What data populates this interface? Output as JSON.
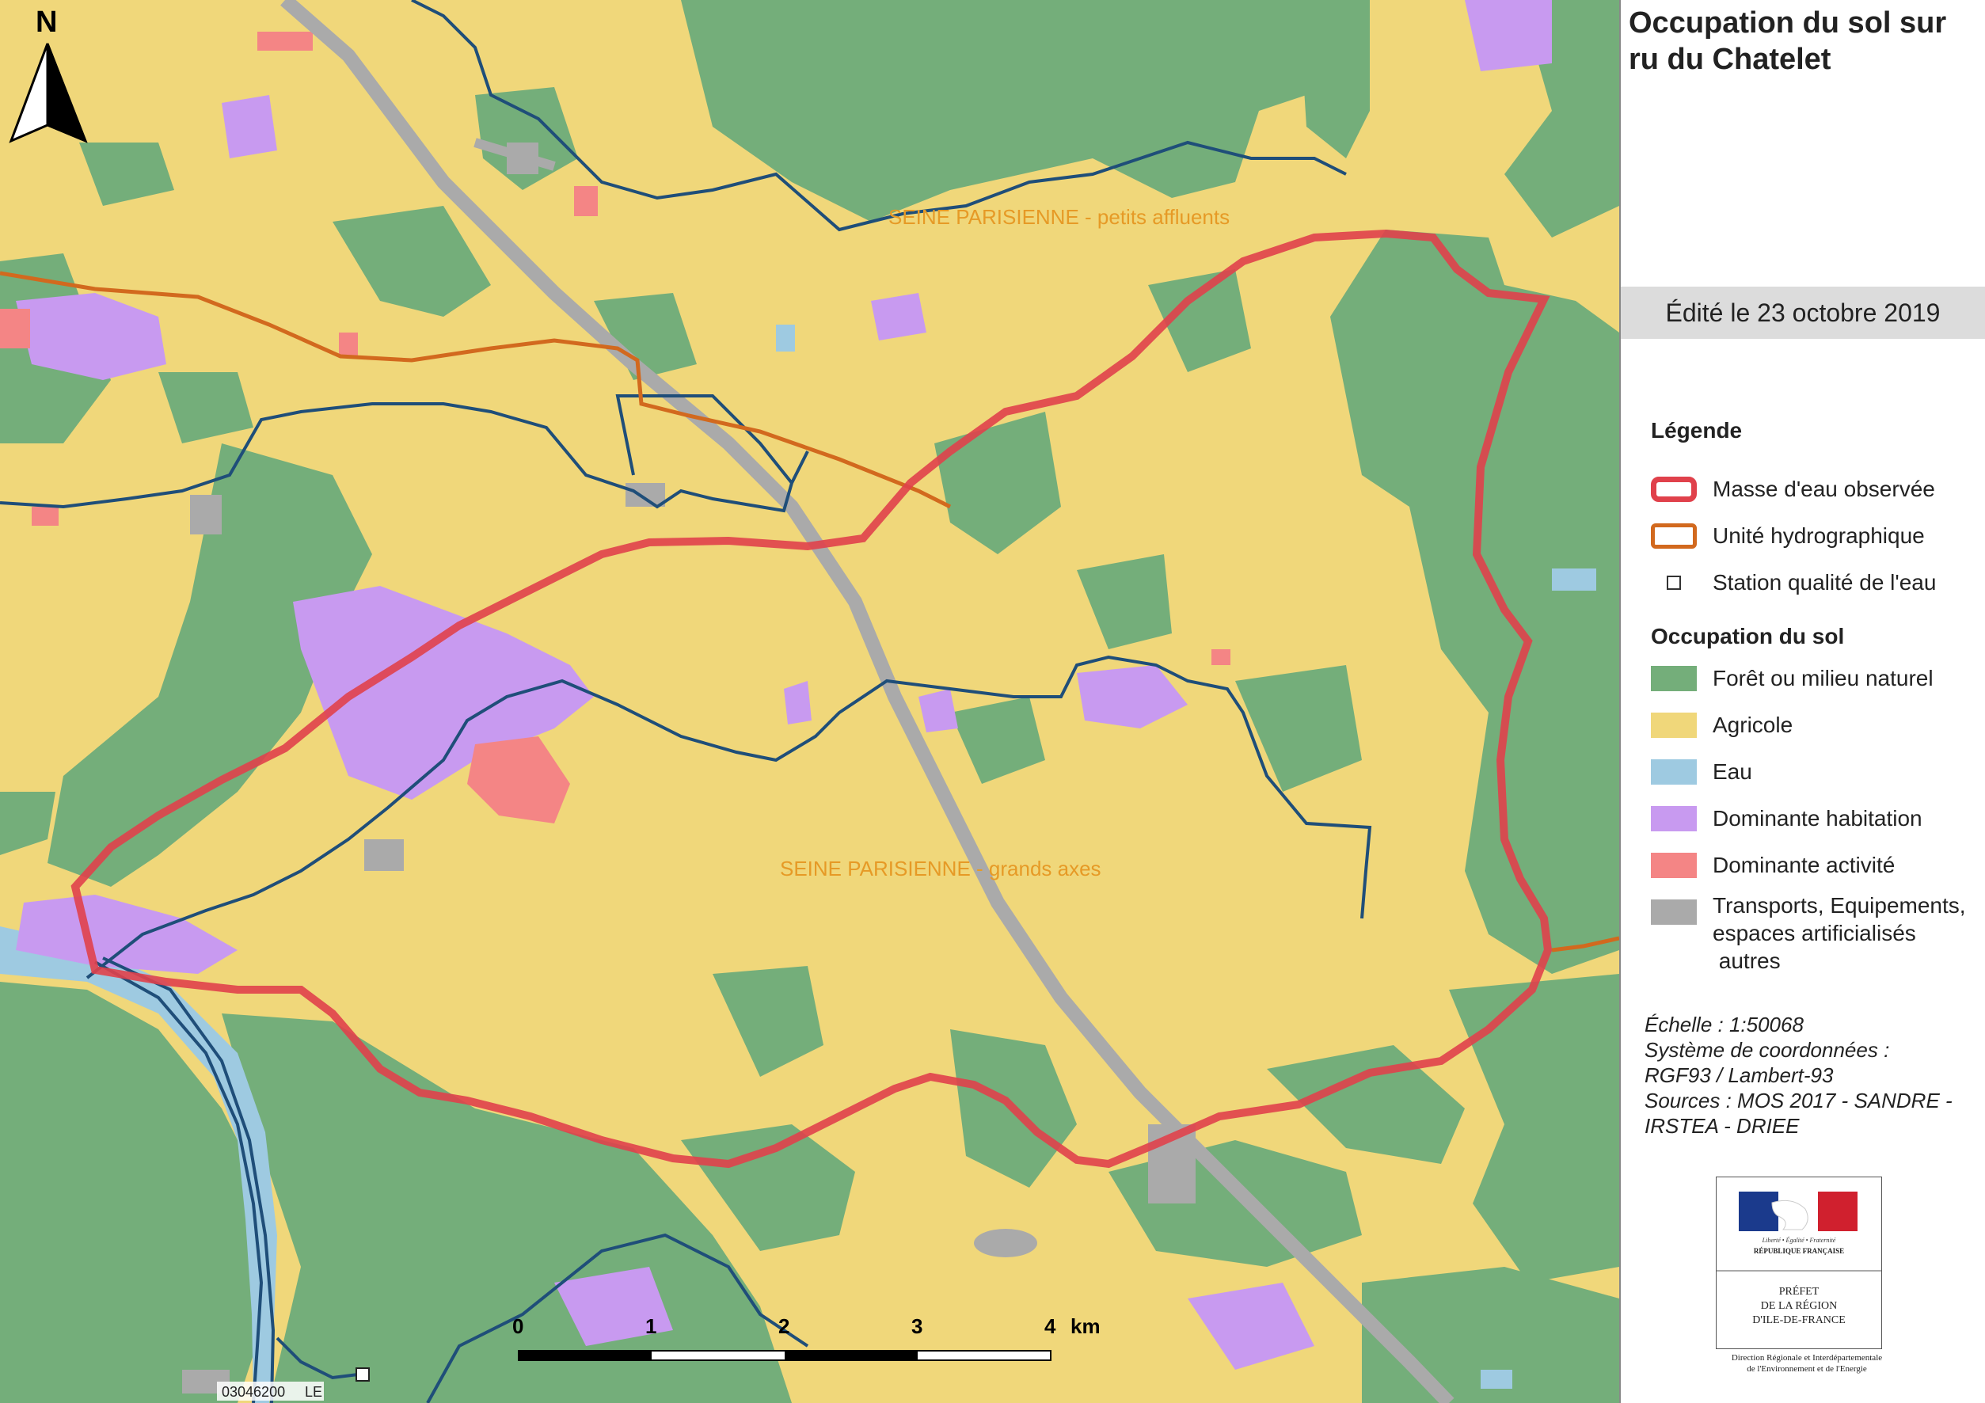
{
  "title": "Occupation du sol sur ru du Chatelet",
  "edition_date": "Édité le 23 octobre 2019",
  "north_label": "N",
  "map_labels": {
    "upper_unit": "SEINE PARISIENNE - petits affluents",
    "lower_unit": "SEINE PARISIENNE - grands axes",
    "station_code": "03046200",
    "station_suffix": "LE"
  },
  "scalebar": {
    "ticks": [
      "0",
      "1",
      "2",
      "3",
      "4"
    ],
    "unit": "km"
  },
  "legend": {
    "heading": "Légende",
    "items": [
      {
        "label": "Masse d'eau observée",
        "color": "#e0414b",
        "kind": "outline"
      },
      {
        "label": "Unité hydrographique",
        "color": "#d2691e",
        "kind": "outline"
      },
      {
        "label": "Station qualité de l'eau",
        "color": "#333333",
        "kind": "point"
      }
    ],
    "landuse_heading": "Occupation du sol",
    "landuse": [
      {
        "label": "Forêt ou milieu naturel",
        "color": "#74ae7a"
      },
      {
        "label": "Agricole",
        "color": "#f0d77a"
      },
      {
        "label": "Eau",
        "color": "#9ecae1"
      },
      {
        "label": "Dominante habitation",
        "color": "#c89af0"
      },
      {
        "label": "Dominante activité",
        "color": "#f48585"
      },
      {
        "label": "Transports, Equipements, espaces artificialisés autres",
        "lines": [
          "Transports, Equipements,",
          "espaces artificialisés",
          " autres"
        ],
        "color": "#aaaaaa"
      }
    ]
  },
  "meta": {
    "scale": "Échelle :  1:50068",
    "crs_line1": "Système de coordonnées :",
    "crs_line2": "RGF93 / Lambert-93",
    "sources_line1": "Sources : MOS 2017 - SANDRE -",
    "sources_line2": "IRSTEA - DRIEE"
  },
  "logo": {
    "motto": "Liberté • Égalité • Fraternité",
    "republic": "RÉPUBLIQUE FRANÇAISE",
    "prefet_lines": [
      "PRÉFET",
      "DE LA RÉGION",
      "D'ILE-DE-FRANCE"
    ],
    "subtitle_lines": [
      "Direction Régionale et Interdépartementale",
      "de l'Environnement et de l'Energie"
    ]
  }
}
